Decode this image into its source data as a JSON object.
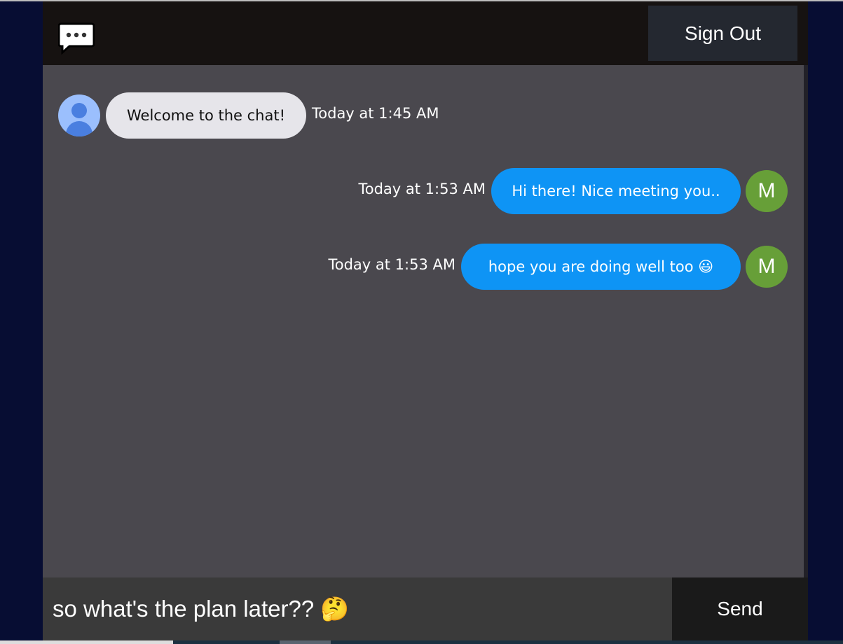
{
  "header": {
    "logo_icon": "chat-bubble-dots-icon",
    "signout_label": "Sign Out"
  },
  "messages": [
    {
      "sender": "other",
      "avatar": "default-user-icon",
      "text": "Welcome to the chat!",
      "time": "Today at 1:45 AM"
    },
    {
      "sender": "me",
      "avatar_letter": "M",
      "text": "Hi there! Nice meeting you..",
      "time": "Today at 1:53 AM"
    },
    {
      "sender": "me",
      "avatar_letter": "M",
      "text": "hope you are doing well too 😃",
      "time": "Today at 1:53 AM"
    }
  ],
  "composer": {
    "value": "so what's the plan later?? 🤔",
    "send_label": "Send"
  },
  "colors": {
    "sent_bubble": "#0e94f5",
    "received_bubble": "#e6e5ea",
    "avatar_m": "#679f38",
    "chat_bg": "#4a484e"
  }
}
